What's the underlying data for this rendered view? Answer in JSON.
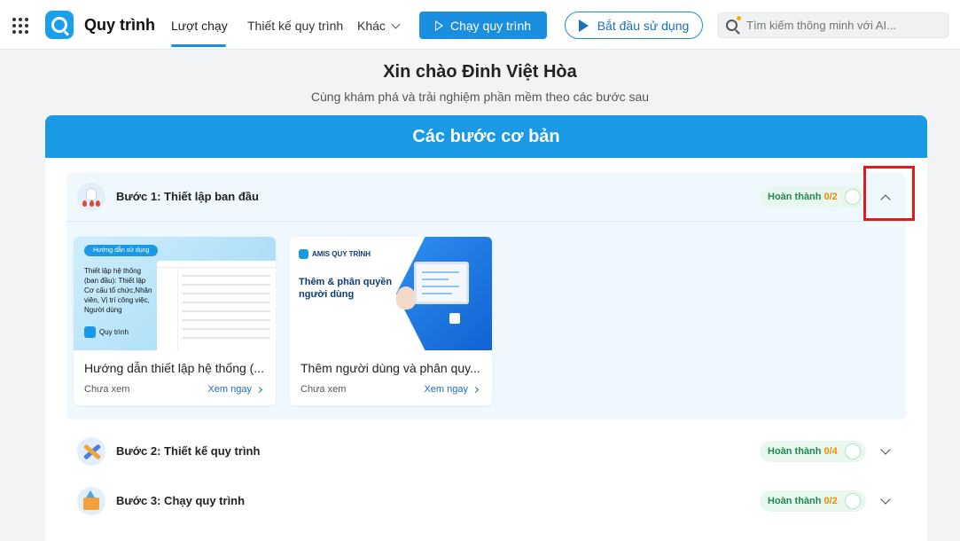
{
  "app": {
    "title": "Quy trình"
  },
  "nav": {
    "tabs": [
      {
        "label": "Lượt chạy"
      },
      {
        "label": "Thiết kế quy trình"
      },
      {
        "label": "Khác"
      }
    ],
    "run_button": "Chạy quy trình",
    "start_button": "Bắt đầu sử dụng",
    "search_placeholder": "Tìm kiếm thông minh với AI..."
  },
  "greeting": {
    "title": "Xin chào Đinh Việt Hòa",
    "subtitle": "Cùng khám phá và trải nghiệm phần mềm theo các bước sau"
  },
  "section": {
    "title": "Các bước cơ bản"
  },
  "steps": [
    {
      "label": "Bước 1: Thiết lập ban đầu",
      "status_label": "Hoàn thành",
      "count": "0/2",
      "expanded": true
    },
    {
      "label": "Bước 2: Thiết kế quy trình",
      "status_label": "Hoàn thành",
      "count": "0/4",
      "expanded": false
    },
    {
      "label": "Bước 3: Chạy quy trình",
      "status_label": "Hoàn thành",
      "count": "0/2",
      "expanded": false
    }
  ],
  "tutorials": [
    {
      "thumb_pill": "Hướng dẫn sử dụng",
      "thumb_text": "Thiết lập hệ thống (ban đầu): Thiết lập Cơ cấu tổ chức,Nhân viên, Vị trí công việc, Người dùng",
      "thumb_brand": "Quy trình",
      "title": "Hướng dẫn thiết lập hệ thống (...",
      "status": "Chưa xem",
      "link": "Xem ngay"
    },
    {
      "thumb_brand": "AMIS QUY TRÌNH",
      "thumb_text": "Thêm & phân quyền người dùng",
      "title": "Thêm người dùng và phân quy...",
      "status": "Chưa xem",
      "link": "Xem ngay"
    }
  ],
  "colors": {
    "primary": "#1a9ae4",
    "accent_blue": "#1a8fe0",
    "success_text": "#1f8a4c",
    "count_text": "#f08a00",
    "highlight": "#e01b1b"
  }
}
